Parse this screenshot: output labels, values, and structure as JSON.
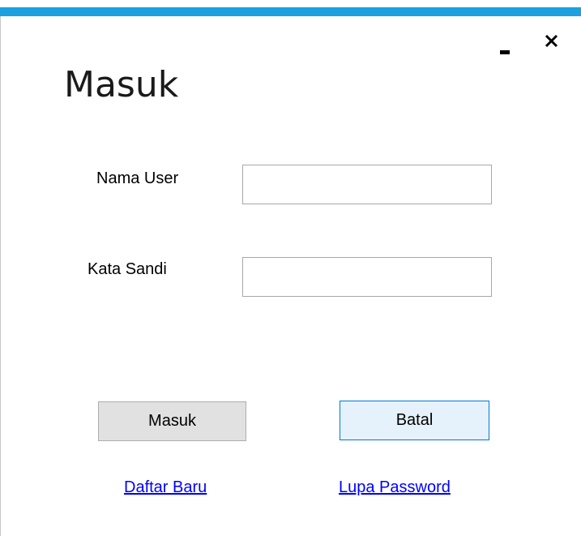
{
  "window": {
    "accent_color": "#1ba1e2",
    "minimize_icon": "minimize-icon",
    "close_icon": "close-icon"
  },
  "form": {
    "title": "Masuk",
    "username_label": "Nama User",
    "username_value": "",
    "password_label": "Kata Sandi",
    "password_value": ""
  },
  "buttons": {
    "login_label": "Masuk",
    "cancel_label": "Batal"
  },
  "links": {
    "register_label": "Daftar Baru",
    "forgot_label": "Lupa Password",
    "link_color": "#0000ff"
  }
}
